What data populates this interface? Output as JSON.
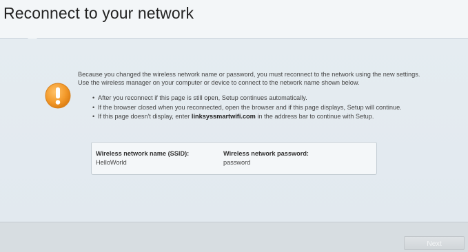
{
  "page": {
    "title": "Reconnect to your network"
  },
  "message": {
    "intro": "Because you changed the wireless network name or password, you must reconnect to the network using the new settings. Use the wireless manager on your computer or device to connect to the network name shown below.",
    "bullets": [
      "After you reconnect if this page is still open, Setup continues automatically.",
      "If the browser closed when you reconnected, open the browser and if this page displays, Setup will continue."
    ],
    "bullet3_prefix": "If this page doesn't display, enter ",
    "bullet3_link": "linksyssmartwifi.com",
    "bullet3_suffix": " in the address bar to continue with Setup."
  },
  "network": {
    "ssid_label": "Wireless network name (SSID):",
    "ssid_value": "HelloWorld",
    "password_label": "Wireless network password:",
    "password_value": "password"
  },
  "footer": {
    "next_label": "Next"
  },
  "colors": {
    "warning": "#f19a2e",
    "background": "#e4ebf0",
    "footer": "#d7dde1"
  },
  "icons": {
    "warning": "exclamation-circle-icon"
  }
}
